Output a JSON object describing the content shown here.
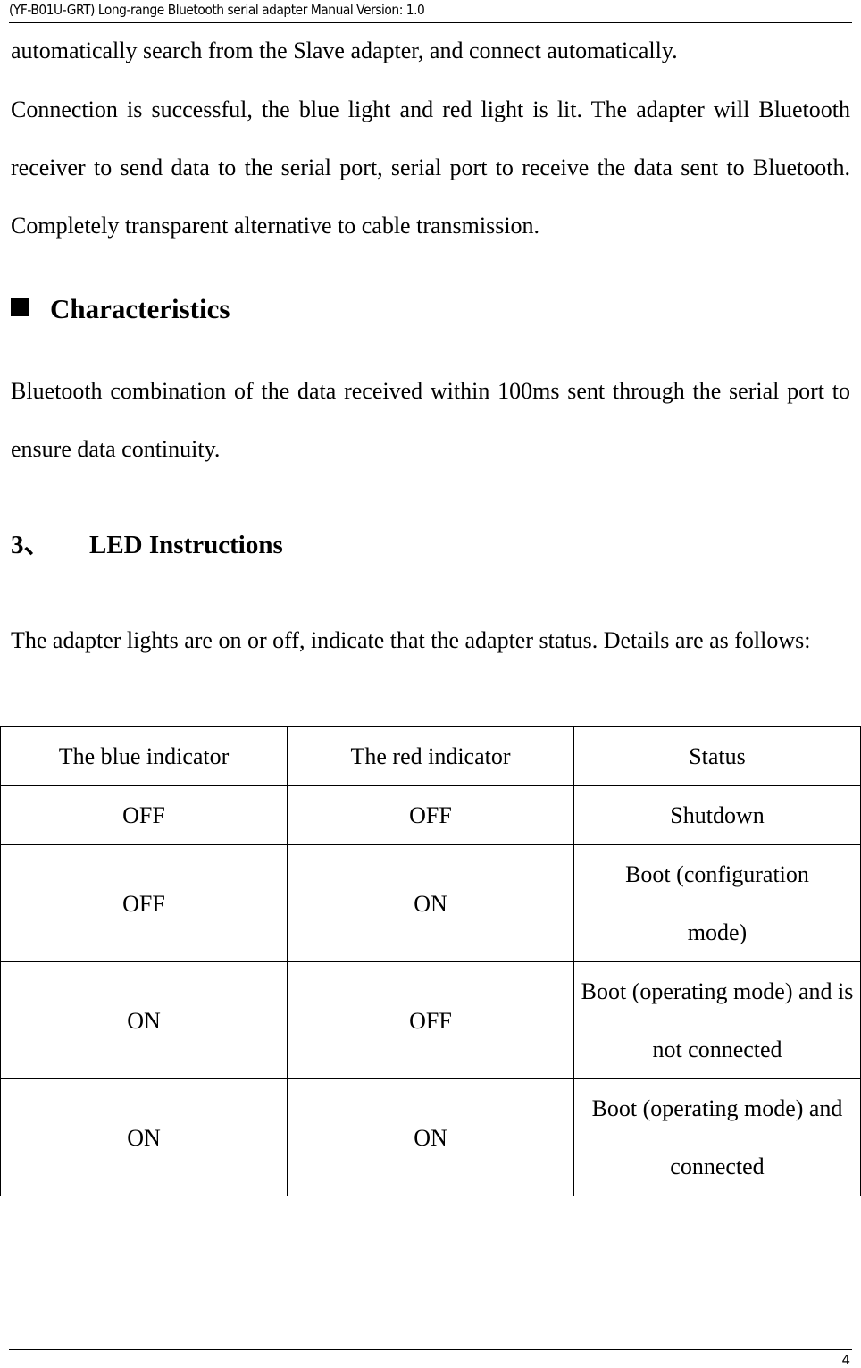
{
  "header": {
    "title": "(YF-B01U-GRT) Long-range Bluetooth serial adapter Manual Version: 1.0"
  },
  "paragraphs": {
    "intro_line": "automatically search from the Slave adapter, and connect automatically.",
    "connection": "Connection is successful, the blue light and red light is lit. The adapter will Bluetooth receiver to send data to the serial port, serial port to receive the data sent to Bluetooth. Completely transparent alternative to cable transmission.",
    "characteristics": "Bluetooth combination of the data received within 100ms sent through the serial port to ensure data continuity.",
    "led_intro": "The adapter lights are on or off, indicate that the adapter status. Details are as follows:"
  },
  "headings": {
    "characteristics": "Characteristics",
    "led_number": "3、",
    "led_title": "LED Instructions"
  },
  "led_table": {
    "columns": [
      "The blue indicator",
      "The red indicator",
      "Status"
    ],
    "rows": [
      [
        "OFF",
        "OFF",
        "Shutdown"
      ],
      [
        "OFF",
        "ON",
        "Boot (configuration mode)"
      ],
      [
        "ON",
        "OFF",
        "Boot (operating mode) and is not connected"
      ],
      [
        "ON",
        "ON",
        "Boot (operating mode) and connected"
      ]
    ]
  },
  "footer": {
    "page_number": "4"
  }
}
